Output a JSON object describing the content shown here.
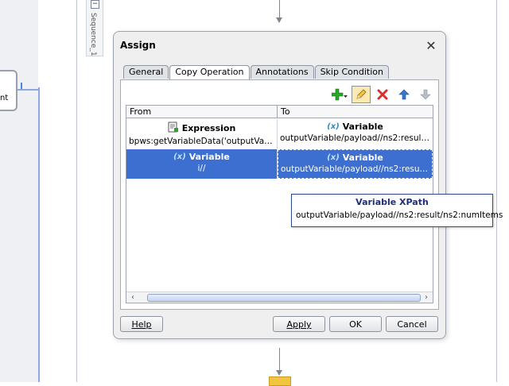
{
  "canvas": {
    "sequence_label": "Sequence_1",
    "collapse_glyph": "−",
    "node_label_fragment": "nt"
  },
  "dialog": {
    "title": "Assign",
    "close_icon": "close-icon",
    "tabs": [
      {
        "label": "General",
        "active": false
      },
      {
        "label": "Copy Operation",
        "active": true
      },
      {
        "label": "Annotations",
        "active": false
      },
      {
        "label": "Skip Condition",
        "active": false
      }
    ],
    "toolbar": {
      "icons": [
        "add-dropdown-icon",
        "edit-icon",
        "delete-icon",
        "move-up-icon",
        "move-down-icon"
      ]
    },
    "table": {
      "headers": {
        "from": "From",
        "to": "To"
      },
      "rows": [
        {
          "from_kind": "Expression",
          "from_value": "bpws:getVariableData('outputVaria...",
          "to_kind": "Variable",
          "to_value": "outputVariable/payload//ns2:result...",
          "selected": false
        },
        {
          "from_kind": "Variable",
          "from_value": "i//",
          "to_kind": "Variable",
          "to_value": "outputVariable/payload//ns2:result...",
          "selected": true
        }
      ]
    },
    "tooltip": {
      "title": "Variable XPath",
      "value": "outputVariable/payload//ns2:result/ns2:numItems"
    },
    "buttons": {
      "help": "Help",
      "apply": "Apply",
      "ok": "OK",
      "cancel": "Cancel"
    }
  },
  "colors": {
    "selection": "#3c6fd0",
    "tooltip_title": "#1f2f78",
    "delete": "#d9302b",
    "add": "#2aa52a"
  }
}
